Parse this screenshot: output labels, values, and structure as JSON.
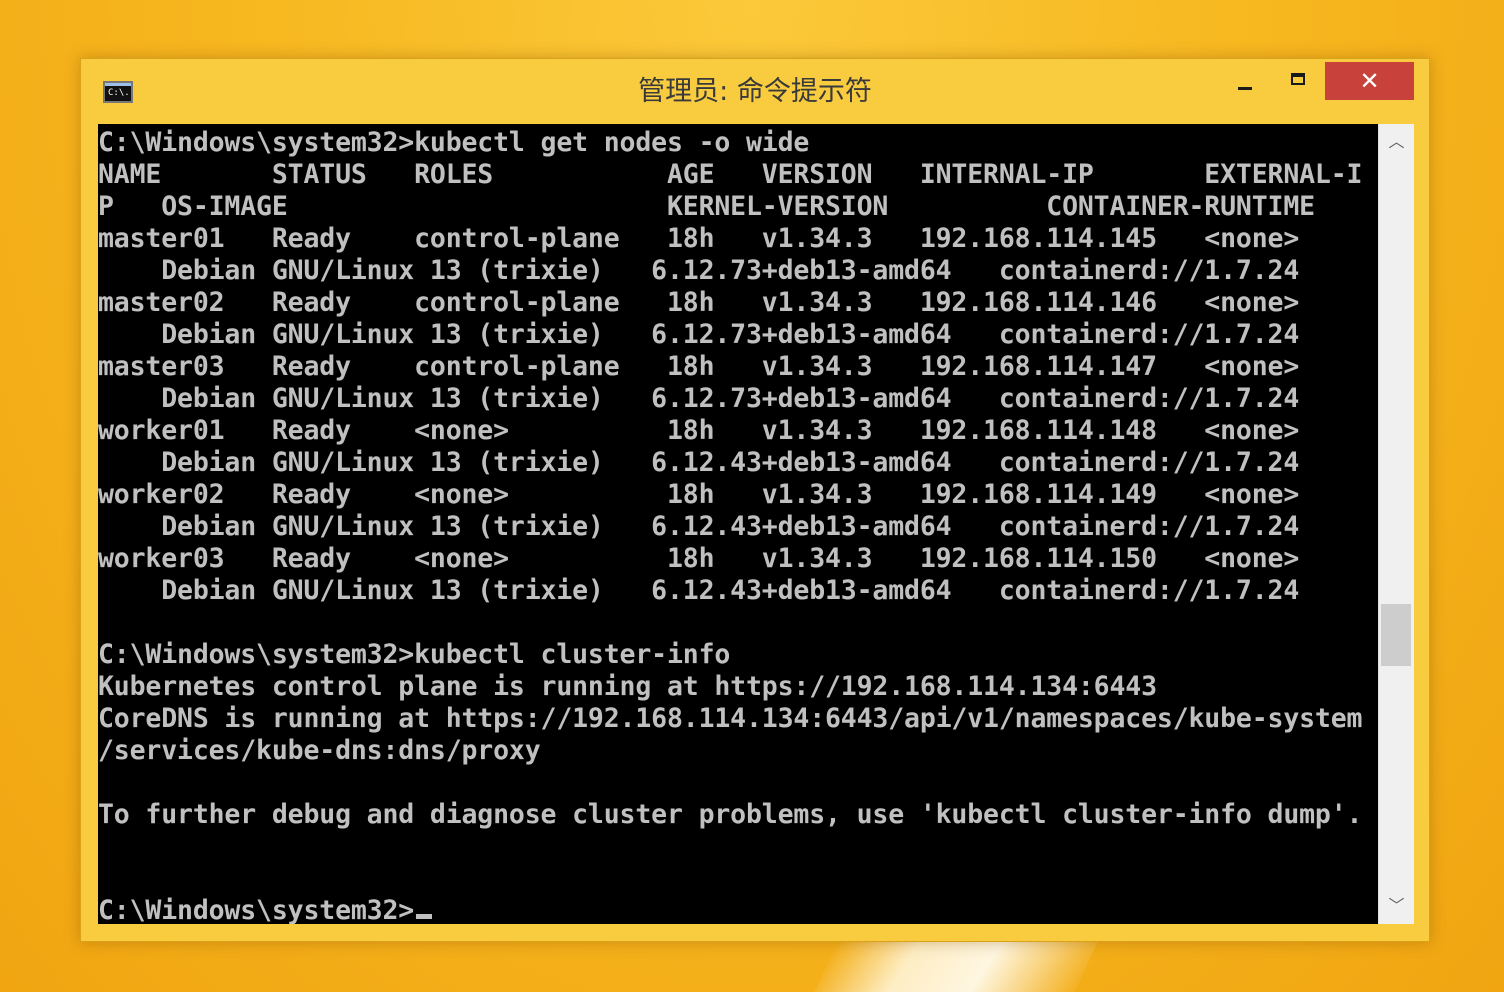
{
  "window": {
    "title": "管理员: 命令提示符",
    "app_icon_text": "C:\\."
  },
  "controls": {
    "close_glyph": "✕"
  },
  "scrollbar": {
    "up_glyph": "︿",
    "down_glyph": "﹀"
  },
  "console": {
    "lines": [
      "C:\\Windows\\system32>kubectl get nodes -o wide",
      "NAME       STATUS   ROLES           AGE   VERSION   INTERNAL-IP       EXTERNAL-I",
      "P   OS-IMAGE                        KERNEL-VERSION          CONTAINER-RUNTIME",
      "master01   Ready    control-plane   18h   v1.34.3   192.168.114.145   <none>",
      "    Debian GNU/Linux 13 (trixie)   6.12.73+deb13-amd64   containerd://1.7.24",
      "master02   Ready    control-plane   18h   v1.34.3   192.168.114.146   <none>",
      "    Debian GNU/Linux 13 (trixie)   6.12.73+deb13-amd64   containerd://1.7.24",
      "master03   Ready    control-plane   18h   v1.34.3   192.168.114.147   <none>",
      "    Debian GNU/Linux 13 (trixie)   6.12.73+deb13-amd64   containerd://1.7.24",
      "worker01   Ready    <none>          18h   v1.34.3   192.168.114.148   <none>",
      "    Debian GNU/Linux 13 (trixie)   6.12.43+deb13-amd64   containerd://1.7.24",
      "worker02   Ready    <none>          18h   v1.34.3   192.168.114.149   <none>",
      "    Debian GNU/Linux 13 (trixie)   6.12.43+deb13-amd64   containerd://1.7.24",
      "worker03   Ready    <none>          18h   v1.34.3   192.168.114.150   <none>",
      "    Debian GNU/Linux 13 (trixie)   6.12.43+deb13-amd64   containerd://1.7.24",
      "",
      "C:\\Windows\\system32>kubectl cluster-info",
      "Kubernetes control plane is running at https://192.168.114.134:6443",
      "CoreDNS is running at https://192.168.114.134:6443/api/v1/namespaces/kube-system",
      "/services/kube-dns:dns/proxy",
      "",
      "To further debug and diagnose cluster problems, use 'kubectl cluster-info dump'.",
      "",
      "",
      "C:\\Windows\\system32>"
    ]
  },
  "colors": {
    "console_bg": "#000000",
    "console_fg": "#c0c0c0",
    "titlebar": "#f8cc3e",
    "close_button": "#c9413b",
    "desktop": "#f6b51c"
  }
}
